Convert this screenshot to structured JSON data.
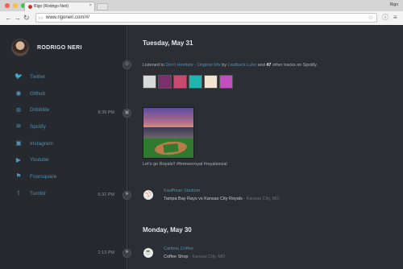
{
  "browser": {
    "tab_title": "Rigo (Rodrigo Neri)",
    "profile_name": "Rigo",
    "url": "www.rigoneri.com/#/",
    "traffic_lights": [
      "#fc5b57",
      "#fdbc40",
      "#34c84a"
    ]
  },
  "profile": {
    "name": "RODRIGO NERI"
  },
  "nav": [
    {
      "label": "Twitter",
      "icon": "twitter-icon",
      "glyph": "🐦"
    },
    {
      "label": "Github",
      "icon": "github-icon",
      "glyph": "◉"
    },
    {
      "label": "Dribbble",
      "icon": "dribbble-icon",
      "glyph": "⊛"
    },
    {
      "label": "Spotify",
      "icon": "spotify-icon",
      "glyph": "≋"
    },
    {
      "label": "Instagram",
      "icon": "instagram-icon",
      "glyph": "▣"
    },
    {
      "label": "Youtube",
      "icon": "youtube-icon",
      "glyph": "▶"
    },
    {
      "label": "Foursquare",
      "icon": "foursquare-icon",
      "glyph": "⚑"
    },
    {
      "label": "Tumblr",
      "icon": "tumblr-icon",
      "glyph": "t"
    }
  ],
  "timeline": {
    "day1": "Tuesday, May 31",
    "spotify": {
      "prefix": "Listened to ",
      "track": "Don't Hesitate - Original Mix",
      "by": " by ",
      "artist": "Laidback Luke",
      "and": " and ",
      "count": "47",
      "suffix": " other tracks on Spotify.",
      "album_colors": [
        "#d9d9d9",
        "#7b2f6b",
        "#c94a6f",
        "#1fb5b0",
        "#f0e6d2",
        "#c04fbf"
      ]
    },
    "instagram": {
      "time": "8:39 PM",
      "caption": "Let's go Royals!! #foreverroyal #royalsocial"
    },
    "checkin1": {
      "time": "6:32 PM",
      "venue": "Kauffman Stadium",
      "detail": "Tampa Bay Rays vs Kansas City Royals",
      "location": "Kansas City, MO"
    },
    "day2": "Monday, May 30",
    "checkin2": {
      "time": "2:13 PM",
      "venue": "Caribou Coffee",
      "detail": "Coffee Shop",
      "location": "Kansas City, MO"
    }
  }
}
